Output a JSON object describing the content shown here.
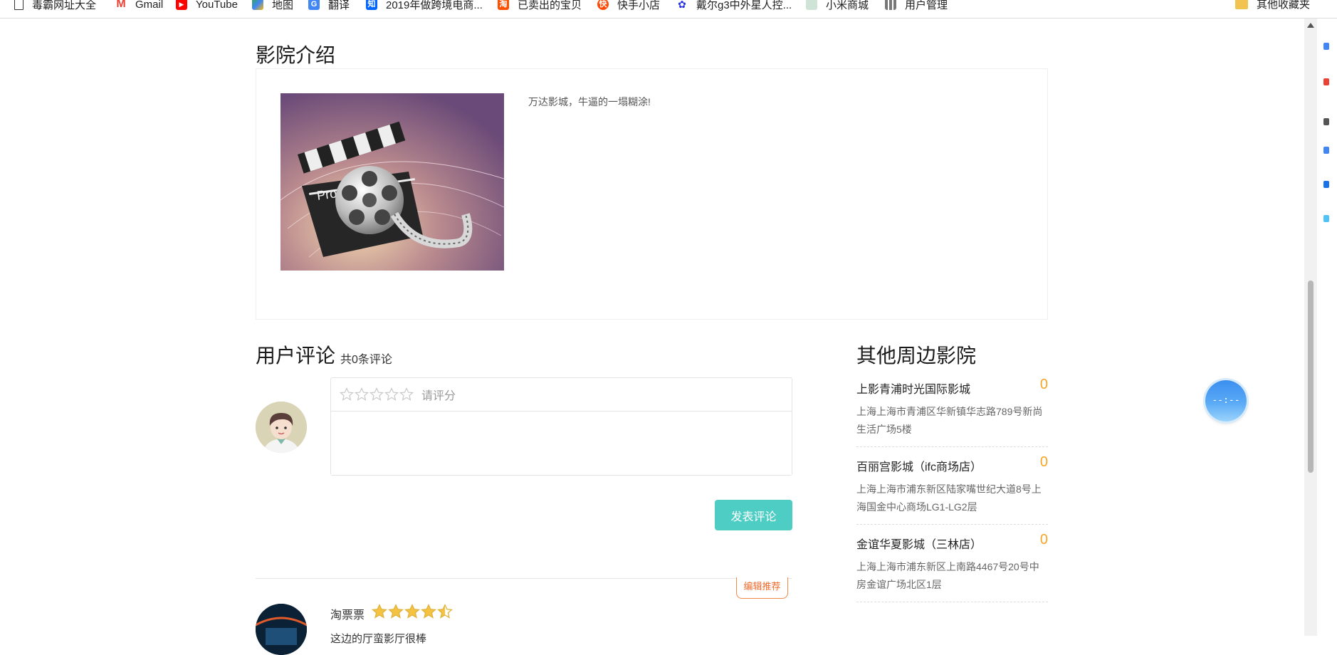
{
  "bookmarks": {
    "items": [
      {
        "label": "毒霸网址大全",
        "icon": "page-icon",
        "color": "#ffffff"
      },
      {
        "label": "Gmail",
        "icon": "gmail-icon",
        "color": "#ea4335"
      },
      {
        "label": "YouTube",
        "icon": "youtube-icon",
        "color": "#ff0000"
      },
      {
        "label": "地图",
        "icon": "maps-icon",
        "color": "#34a853"
      },
      {
        "label": "翻译",
        "icon": "translate-icon",
        "color": "#4285f4"
      },
      {
        "label": "2019年做跨境电商...",
        "icon": "zhihu-icon",
        "color": "#0066ff"
      },
      {
        "label": "已卖出的宝贝",
        "icon": "taobao-icon",
        "color": "#ff5000"
      },
      {
        "label": "快手小店",
        "icon": "kuaishou-icon",
        "color": "#ff4906"
      },
      {
        "label": "戴尔g3中外星人控...",
        "icon": "baidu-icon",
        "color": "#2932e1"
      },
      {
        "label": "小米商城",
        "icon": "mi-icon",
        "color": "#9fb8a8"
      },
      {
        "label": "用户管理",
        "icon": "grid-icon",
        "color": "#888888"
      }
    ],
    "other_label": "其他收藏夹"
  },
  "intro": {
    "title": "影院介绍",
    "text": "万达影城，牛逼的一塌糊涂!"
  },
  "comments": {
    "title": "用户评论",
    "count": "共0条评论",
    "rating_hint": "请评分",
    "rating_max": 5,
    "rating_value": 0,
    "submit_label": "发表评论"
  },
  "review": {
    "badge": "编辑推荐",
    "user": "淘票票",
    "rating": 4.5,
    "text": "这边的厅蛮影厅很棒"
  },
  "sidebar": {
    "title": "其他周边影院",
    "cinemas": [
      {
        "name": "上影青浦时光国际影城",
        "score": "0",
        "address": "上海上海市青浦区华新镇华志路789号新尚生活广场5楼"
      },
      {
        "name": "百丽宫影城（ifc商场店）",
        "score": "0",
        "address": "上海上海市浦东新区陆家嘴世纪大道8号上海国金中心商场LG1-LG2层"
      },
      {
        "name": "金谊华夏影城（三林店）",
        "score": "0",
        "address": "上海上海市浦东新区上南路4467号20号中房金谊广场北区1层"
      }
    ]
  },
  "float_button": {
    "label": "--:--"
  },
  "colors": {
    "accent": "#4ecdc4",
    "score": "#f5a623",
    "badge": "#f06a2a"
  }
}
